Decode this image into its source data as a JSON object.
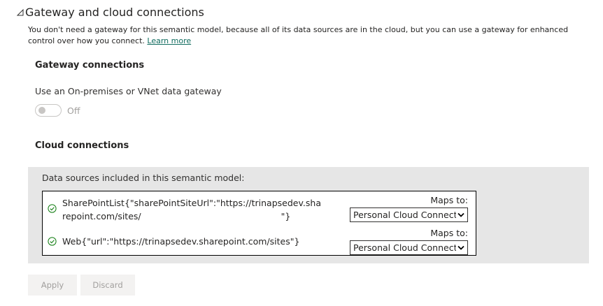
{
  "section": {
    "title": "Gateway and cloud connections",
    "description": "You don't need a gateway for this semantic model, because all of its data sources are in the cloud, but you can use a gateway for enhanced control over how you connect.",
    "learn_more": "Learn more"
  },
  "gateway": {
    "heading": "Gateway connections",
    "toggle_label": "Use an On-premises or VNet data gateway",
    "toggle_state": "Off"
  },
  "cloud": {
    "heading": "Cloud connections",
    "panel_label": "Data sources included in this semantic model:",
    "data_sources": [
      {
        "name_part1": "SharePointList{\"sharePointSiteUrl\":\"https://trinapsedev.sharepoint.com/sites/",
        "name_part2": "\"}",
        "maps_to_label": "Maps to:",
        "selected": "Personal Cloud Connection"
      },
      {
        "name_part1": "Web{\"url\":\"https://trinapsedev.sharepoint.com/sites\"}",
        "maps_to_label": "Maps to:",
        "selected": "Personal Cloud Connection"
      }
    ]
  },
  "actions": {
    "apply": "Apply",
    "discard": "Discard"
  },
  "colors": {
    "link": "#0f6b5e",
    "check": "#107c10",
    "panel_bg": "#e6e6e6",
    "disabled_text": "#a19f9d"
  }
}
